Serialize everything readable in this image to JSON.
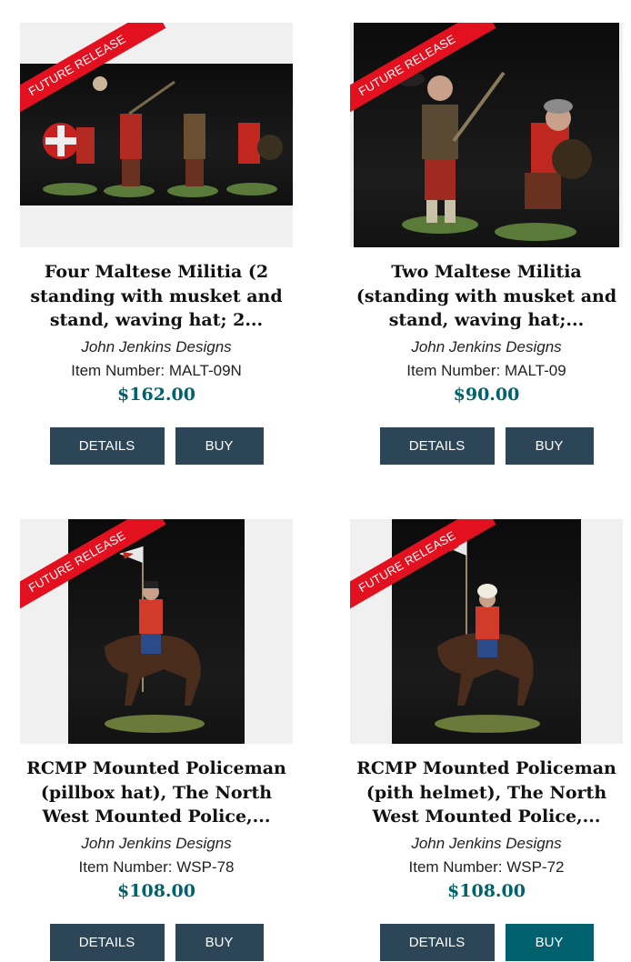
{
  "badge_text": "FUTURE RELEASE",
  "colors": {
    "badge": "#e3101f",
    "button": "#2c4657",
    "button_active": "#00606e",
    "price": "#00626d"
  },
  "products": [
    {
      "title": "Four Maltese Militia (2 standing with musket and stand, waving hat; 2...",
      "brand": "John Jenkins Designs",
      "item_number": "Item Number: MALT-09N",
      "price": "$162.00",
      "details_label": "DETAILS",
      "buy_label": "BUY"
    },
    {
      "title": "Two Maltese Militia (standing with musket and stand, waving hat;...",
      "brand": "John Jenkins Designs",
      "item_number": "Item Number: MALT-09",
      "price": "$90.00",
      "details_label": "DETAILS",
      "buy_label": "BUY"
    },
    {
      "title": "RCMP Mounted Policeman (pillbox hat), The North West Mounted Police,...",
      "brand": "John Jenkins Designs",
      "item_number": "Item Number: WSP-78",
      "price": "$108.00",
      "details_label": "DETAILS",
      "buy_label": "BUY"
    },
    {
      "title": "RCMP Mounted Policeman (pith helmet), The North West Mounted Police,...",
      "brand": "John Jenkins Designs",
      "item_number": "Item Number: WSP-72",
      "price": "$108.00",
      "details_label": "DETAILS",
      "buy_label": "BUY"
    }
  ]
}
